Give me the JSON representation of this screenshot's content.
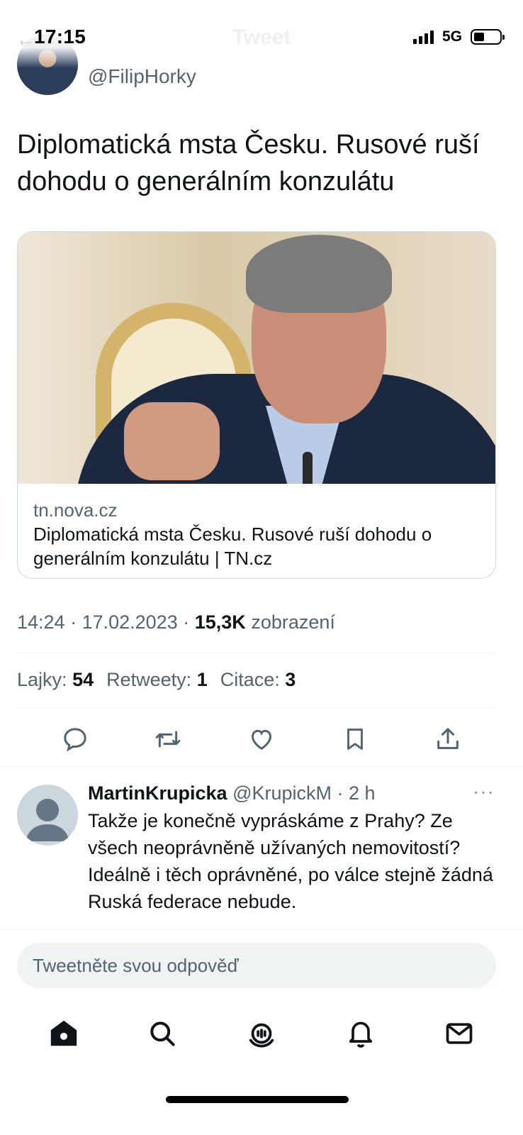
{
  "status_bar": {
    "time": "17:15",
    "network": "5G",
    "nav_title": "Tweet",
    "back_icon": "arrow-left-icon",
    "battery_level_percent": 30
  },
  "tweet": {
    "handle": "@FilipHorky",
    "text": "Diplomatická msta Česku. Rusové ruší dohodu o generálním konzulátu",
    "card": {
      "domain": "tn.nova.cz",
      "title": "Diplomatická msta Česku. Rusové ruší dohodu o generálním konzulátu | TN.cz"
    },
    "time": "14:24",
    "date": "17.02.2023",
    "views_count": "15,3K",
    "views_label": "zobrazení",
    "stats": {
      "likes_label": "Lajky:",
      "likes": "54",
      "retweets_label": "Retweety:",
      "retweets": "1",
      "quotes_label": "Citace:",
      "quotes": "3"
    },
    "actions": [
      "reply-icon",
      "retweet-icon",
      "like-icon",
      "bookmark-icon",
      "share-icon"
    ]
  },
  "reply": {
    "name": "MartinKrupicka",
    "handle": "@KrupickM",
    "age": "2 h",
    "more": "···",
    "text": "Takže je konečně vypráskáme z Prahy? Ze všech neoprávněně užívaných nemovitostí? Ideálně i těch oprávněné, po válce stejně žádná Ruská federace nebude."
  },
  "composer": {
    "placeholder": "Tweetněte svou odpověď"
  },
  "tabbar": [
    "home-icon",
    "search-icon",
    "spaces-icon",
    "notifications-icon",
    "messages-icon"
  ],
  "colors": {
    "text": "#0f1419",
    "secondary": "#536471",
    "border": "#eff3f4",
    "input_bg": "#eff3f4"
  }
}
